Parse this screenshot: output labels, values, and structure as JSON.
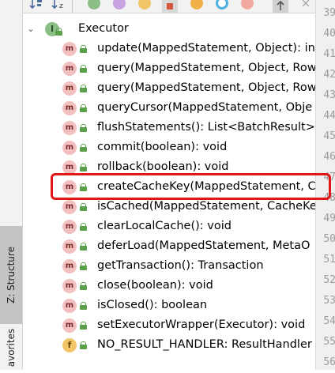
{
  "sidebar": {
    "structure_tab": "Z: Structure",
    "favorites_tab": "avorites"
  },
  "toolbar": {
    "icons": [
      "sort-by-visibility-icon",
      "sort-alphabetically-icon",
      "show-inherited-icon",
      "show-properties-icon",
      "show-fields-icon",
      "show-non-public-icon",
      "show-lambdas-icon",
      "show-anonymous-icon",
      "show-lambda-icon",
      "autoscroll-to-source-icon",
      "close-icon"
    ]
  },
  "gutter": {
    "line_numbers": [
      "39",
      "40",
      "41",
      "42",
      "43",
      "44",
      "45",
      "46",
      "47",
      "48",
      "49",
      "50",
      "51",
      "52",
      "53",
      "54",
      "55",
      "56"
    ]
  },
  "tree": {
    "root": {
      "label": "Executor",
      "badge": "I"
    },
    "members": [
      {
        "label": "update(MappedStatement, Object): in",
        "badge": "m"
      },
      {
        "label": "query(MappedStatement, Object, Row",
        "badge": "m"
      },
      {
        "label": "query(MappedStatement, Object, Row",
        "badge": "m"
      },
      {
        "label": "queryCursor(MappedStatement, Obje",
        "badge": "m"
      },
      {
        "label": "flushStatements(): List<BatchResult>",
        "badge": "m"
      },
      {
        "label": "commit(boolean): void",
        "badge": "m"
      },
      {
        "label": "rollback(boolean): void",
        "badge": "m"
      },
      {
        "label": "createCacheKey(MappedStatement, C",
        "badge": "m"
      },
      {
        "label": "isCached(MappedStatement, CacheKe",
        "badge": "m"
      },
      {
        "label": "clearLocalCache(): void",
        "badge": "m"
      },
      {
        "label": "deferLoad(MappedStatement, MetaO",
        "badge": "m"
      },
      {
        "label": "getTransaction(): Transaction",
        "badge": "m"
      },
      {
        "label": "close(boolean): void",
        "badge": "m"
      },
      {
        "label": "isClosed(): boolean",
        "badge": "m"
      },
      {
        "label": "setExecutorWrapper(Executor): void",
        "badge": "m"
      },
      {
        "label": "NO_RESULT_HANDLER: ResultHandler",
        "badge": "f"
      }
    ]
  },
  "colors": {
    "highlight_box": "#e01818",
    "method_badge": "#f3c0c0",
    "interface_badge": "#8bbf85",
    "field_badge": "#f3c56a",
    "public_lock": "#5aa04b"
  }
}
